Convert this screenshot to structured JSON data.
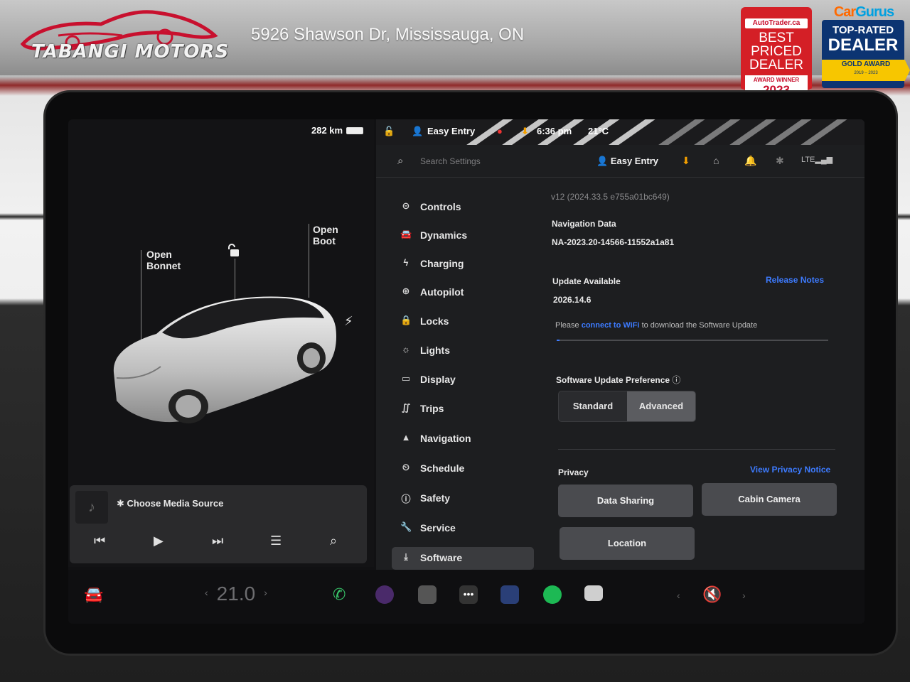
{
  "banner": {
    "dealer_name": "TABANGI MOTORS",
    "address": "5926 Shawson Dr, Mississauga, ON",
    "autotrader_badge": {
      "brand": "AutoTrader.ca",
      "line1": "BEST",
      "line2": "PRICED",
      "line3": "DEALER",
      "award": "AWARD WINNER",
      "year": "2023"
    },
    "cargurus_badge": {
      "brand_a": "Car",
      "brand_b": "Gurus",
      "line1": "TOP-RATED",
      "line2": "DEALER",
      "award": "GOLD AWARD",
      "years": "2019 – 2023"
    }
  },
  "car_panel": {
    "range": "282 km",
    "label_bonnet": "Open\nBonnet",
    "label_boot": "Open\nBoot"
  },
  "media": {
    "source_label": "Choose Media Source"
  },
  "status_bar": {
    "profile": "Easy Entry",
    "time": "6:36 pm",
    "temp": "21°C"
  },
  "search": {
    "placeholder": "Search Settings",
    "profile": "Easy Entry"
  },
  "nav": {
    "items": [
      {
        "label": "Controls",
        "icon": "toggle-icon"
      },
      {
        "label": "Dynamics",
        "icon": "car-icon"
      },
      {
        "label": "Charging",
        "icon": "bolt-icon"
      },
      {
        "label": "Autopilot",
        "icon": "steering-wheel-icon"
      },
      {
        "label": "Locks",
        "icon": "lock-icon"
      },
      {
        "label": "Lights",
        "icon": "sun-icon"
      },
      {
        "label": "Display",
        "icon": "display-icon"
      },
      {
        "label": "Trips",
        "icon": "trips-icon"
      },
      {
        "label": "Navigation",
        "icon": "navigation-icon"
      },
      {
        "label": "Schedule",
        "icon": "clock-icon"
      },
      {
        "label": "Safety",
        "icon": "info-icon"
      },
      {
        "label": "Service",
        "icon": "wrench-icon"
      },
      {
        "label": "Software",
        "icon": "download-icon"
      }
    ],
    "active": "Software"
  },
  "software": {
    "version": "v12 (2024.33.5 e755a01bc649)",
    "nav_data_title": "Navigation Data",
    "nav_data_value": "NA-2023.20-14566-11552a1a81",
    "update_title": "Update Available",
    "update_version": "2026.14.6",
    "release_notes": "Release Notes",
    "wifi_prefix": "Please",
    "wifi_link": "connect to WiFi",
    "wifi_suffix": "to download the Software Update",
    "progress": 0.01,
    "pref_title": "Software Update Preference",
    "pref_options": [
      "Standard",
      "Advanced"
    ],
    "pref_selected": "Advanced",
    "privacy_title": "Privacy",
    "privacy_link": "View Privacy Notice",
    "privacy_buttons": [
      "Data Sharing",
      "Cabin Camera",
      "Location"
    ]
  },
  "dock": {
    "temperature": "21.0"
  },
  "colors": {
    "accent_blue": "#3d7bff",
    "brand_red": "#d41f26",
    "cargurus_navy": "#0c3472",
    "cargurus_gold": "#f7c600"
  }
}
